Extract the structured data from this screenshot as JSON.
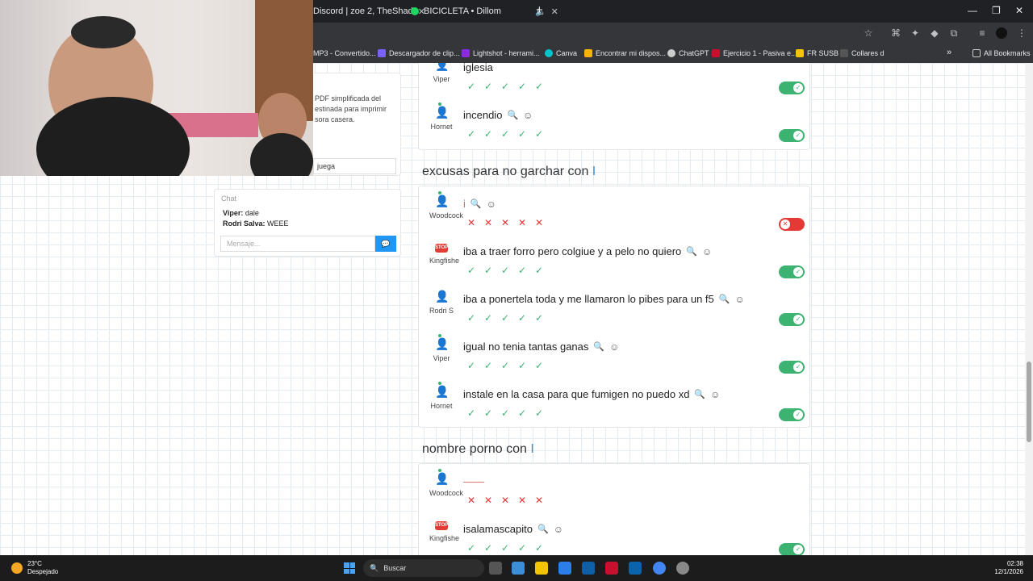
{
  "browser": {
    "tabs": [
      {
        "label": "Discord | zoe 2, TheShad",
        "close": "✕"
      },
      {
        "label": "BICICLETA • Dillom",
        "close": "✕"
      }
    ],
    "new_tab": "+",
    "window_controls": [
      "—",
      "❐",
      "✕"
    ],
    "bookmarks": [
      "MP3 - Convertido...",
      "Descargador de clip...",
      "Lightshot - herrami...",
      "Canva",
      "Encontrar mi dispos...",
      "ChatGPT",
      "Ejercicio 1 - Pasiva e...",
      "FR SUSB",
      "Collares d"
    ],
    "bookmarks_more": "»",
    "all_bookmarks": "All Bookmarks"
  },
  "left_panel": {
    "info_text": "PDF simplificada del estinada para imprimir sora casera.",
    "juega_value": "juega"
  },
  "chat": {
    "title": "Chat",
    "lines": [
      {
        "user": "Viper:",
        "msg": "dale"
      },
      {
        "user": "Rodri Salva:",
        "msg": "WEEE"
      }
    ],
    "placeholder": "Mensaje..."
  },
  "top_entries": [
    {
      "user": "Viper",
      "answer": "iglesia",
      "valid": true
    },
    {
      "user": "Hornet",
      "answer": "incendio",
      "valid": true
    }
  ],
  "sections": [
    {
      "title": "excusas para no garchar con",
      "cursor": "I",
      "entries": [
        {
          "user": "Woodcock",
          "answer": "i",
          "valid": false,
          "avatar": "person"
        },
        {
          "user": "Kingfishe",
          "answer": "iba a traer forro pero colgiue y a pelo no quiero",
          "valid": true,
          "avatar": "stop"
        },
        {
          "user": "Rodri S",
          "answer": "iba a ponertela toda y me llamaron lo pibes para un f5",
          "valid": true,
          "avatar": "person-dark"
        },
        {
          "user": "Viper",
          "answer": "igual no tenia tantas ganas",
          "valid": true,
          "avatar": "person"
        },
        {
          "user": "Hornet",
          "answer": "instale en la casa para que fumigen no puedo xd",
          "valid": true,
          "avatar": "person"
        }
      ]
    },
    {
      "title": "nombre porno con",
      "cursor": "I",
      "entries": [
        {
          "user": "Woodcock",
          "answer": "——",
          "valid": false,
          "avatar": "person"
        },
        {
          "user": "Kingfishe",
          "answer": "isalamascapito",
          "valid": true,
          "avatar": "stop"
        }
      ]
    }
  ],
  "stop_label": "STOP",
  "taskbar": {
    "temp": "23°C",
    "weather": "Despejado",
    "search": "Buscar",
    "time": "02:38",
    "date": "12/1/2026"
  },
  "colors": {
    "ok": "#3cb371",
    "fail": "#e53935",
    "accent": "#3b8fd9"
  }
}
